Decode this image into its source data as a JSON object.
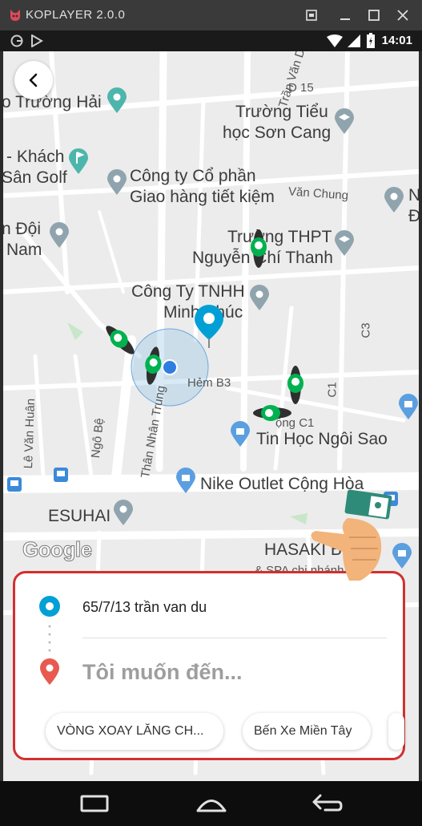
{
  "window": {
    "title": "KOPLAYER 2.0.0"
  },
  "status_bar": {
    "time": "14:01"
  },
  "map": {
    "labels": {
      "truong_hai": "o Trường Hải",
      "truong_tieu_hoc_1": "Trường Tiểu",
      "truong_tieu_hoc_2": "học Sơn Cang",
      "khach_san_1": "- Khách",
      "khach_san_2": "Sân Golf",
      "cong_ty_cp_1": "Công ty Cổ phần",
      "cong_ty_cp_2": "Giao hàng tiết kiệm",
      "van_chung": "Văn Chung",
      "doi_nam_1": "n Đội",
      "doi_nam_2": "Nam",
      "thpt_1": "Trường THPT",
      "thpt_2": "Nguyễn Chí Thanh",
      "tnhh_1": "Công Ty TNHH",
      "tnhh_2": "Minh Phúc",
      "hem_b3": "Hẻm B3",
      "c1_road": "C1",
      "c3_road": "C3",
      "cong_c1": "ộng C1",
      "tin_hoc": "Tin Học Ngôi Sao",
      "nike": "Nike Outlet Cộng Hòa",
      "esuhai": "ESUHAI",
      "hasaki_1": "HASAKI B",
      "hasaki_2": "& SPA chi nhánh",
      "le_van_huan": "Lê Văn Huân",
      "ngo_be": "Ngô Bệ",
      "than_nhan_trung": "Thân Nhân Trung",
      "d15": "D 15",
      "tran_van_du": "Trần Văn Dư",
      "right_n": "N",
      "right_d": "Đ"
    },
    "attribution": "Google"
  },
  "trip": {
    "origin": "65/7/13 trần van du",
    "destination_placeholder": "Tôi muốn đến...",
    "suggestions": [
      "VÒNG XOAY LĂNG CH...",
      "Bến Xe Miền Tây"
    ]
  },
  "colors": {
    "accent": "#00a0d6",
    "brand_green": "#00b14f",
    "highlight_border": "#d32f2f",
    "dest_pin": "#e85a4f"
  },
  "icons": [
    "back-arrow-icon",
    "origin-dot-icon",
    "destination-pin-icon",
    "bike-icon",
    "location-pin-icon",
    "hand-pointer-icon",
    "nav-recent-icon",
    "nav-home-icon",
    "nav-back-icon"
  ]
}
